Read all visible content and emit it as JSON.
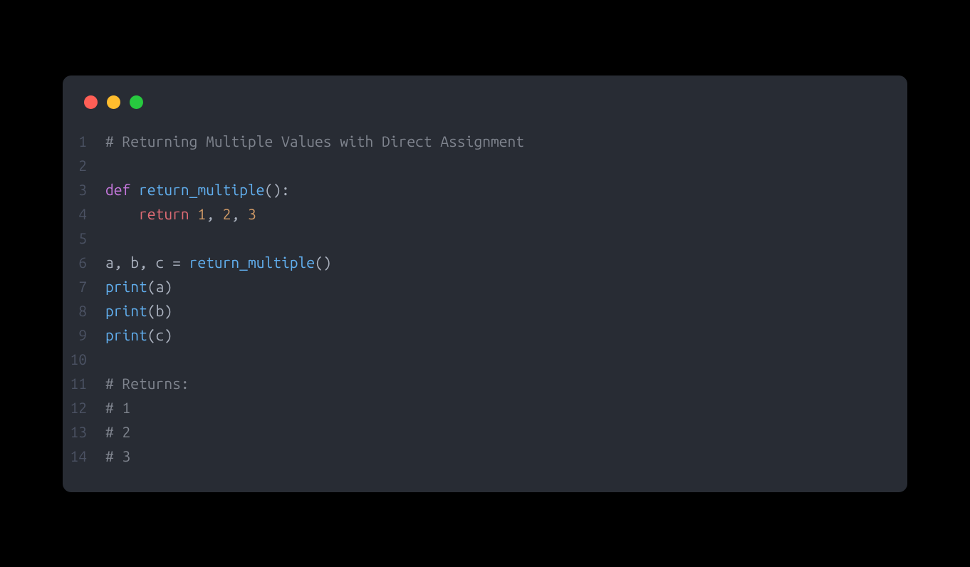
{
  "colors": {
    "window_bg": "#282c34",
    "red": "#ff5f56",
    "yellow": "#ffbd2e",
    "green": "#27c93f",
    "lineno": "#4b5263",
    "comment": "#7f848e",
    "keyword": "#c678dd",
    "keyword_return": "#e06c75",
    "funcdef": "#61afef",
    "number": "#d19a66",
    "punct": "#abb2bf",
    "ident": "#e5c07b"
  },
  "lines": [
    {
      "n": "1",
      "tokens": [
        {
          "cls": "comment",
          "t": "# Returning Multiple Values with Direct Assignment"
        }
      ]
    },
    {
      "n": "2",
      "tokens": []
    },
    {
      "n": "3",
      "tokens": [
        {
          "cls": "keyword",
          "t": "def"
        },
        {
          "cls": "plain",
          "t": " "
        },
        {
          "cls": "funcdef",
          "t": "return_multiple"
        },
        {
          "cls": "punct",
          "t": "():"
        }
      ]
    },
    {
      "n": "4",
      "tokens": [
        {
          "cls": "plain",
          "t": "    "
        },
        {
          "cls": "keyword-return",
          "t": "return"
        },
        {
          "cls": "plain",
          "t": " "
        },
        {
          "cls": "number",
          "t": "1"
        },
        {
          "cls": "punct",
          "t": ", "
        },
        {
          "cls": "number",
          "t": "2"
        },
        {
          "cls": "punct",
          "t": ", "
        },
        {
          "cls": "number",
          "t": "3"
        }
      ]
    },
    {
      "n": "5",
      "tokens": []
    },
    {
      "n": "6",
      "tokens": [
        {
          "cls": "plain",
          "t": "a, b, c "
        },
        {
          "cls": "punct",
          "t": "= "
        },
        {
          "cls": "funccall",
          "t": "return_multiple"
        },
        {
          "cls": "punct",
          "t": "()"
        }
      ]
    },
    {
      "n": "7",
      "tokens": [
        {
          "cls": "funccall",
          "t": "print"
        },
        {
          "cls": "punct",
          "t": "("
        },
        {
          "cls": "plain",
          "t": "a"
        },
        {
          "cls": "punct",
          "t": ")"
        }
      ]
    },
    {
      "n": "8",
      "tokens": [
        {
          "cls": "funccall",
          "t": "print"
        },
        {
          "cls": "punct",
          "t": "("
        },
        {
          "cls": "plain",
          "t": "b"
        },
        {
          "cls": "punct",
          "t": ")"
        }
      ]
    },
    {
      "n": "9",
      "tokens": [
        {
          "cls": "funccall",
          "t": "print"
        },
        {
          "cls": "punct",
          "t": "("
        },
        {
          "cls": "plain",
          "t": "c"
        },
        {
          "cls": "punct",
          "t": ")"
        }
      ]
    },
    {
      "n": "10",
      "tokens": []
    },
    {
      "n": "11",
      "tokens": [
        {
          "cls": "comment",
          "t": "# Returns:"
        }
      ]
    },
    {
      "n": "12",
      "tokens": [
        {
          "cls": "comment",
          "t": "# 1"
        }
      ]
    },
    {
      "n": "13",
      "tokens": [
        {
          "cls": "comment",
          "t": "# 2"
        }
      ]
    },
    {
      "n": "14",
      "tokens": [
        {
          "cls": "comment",
          "t": "# 3"
        }
      ]
    }
  ]
}
